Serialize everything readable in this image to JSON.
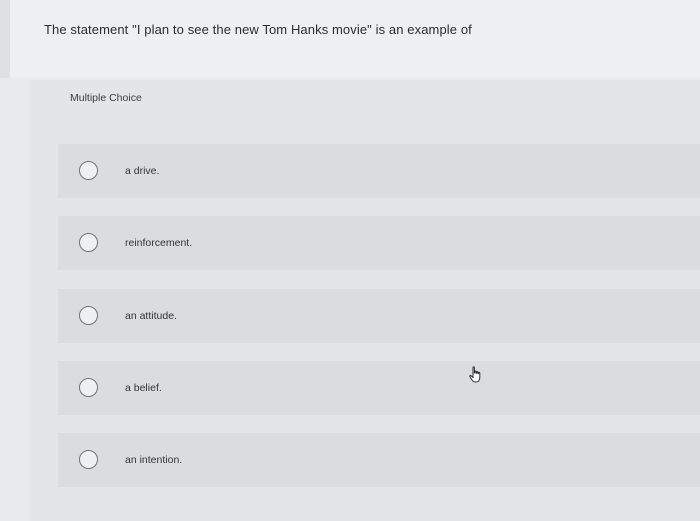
{
  "question": {
    "text": "The statement \"I plan to see the new Tom Hanks movie\" is an example of"
  },
  "answer_panel": {
    "label": "Multiple Choice",
    "options": [
      {
        "label": "a drive.",
        "selected": false
      },
      {
        "label": "reinforcement.",
        "selected": false
      },
      {
        "label": "an attitude.",
        "selected": false
      },
      {
        "label": "a belief.",
        "selected": false
      },
      {
        "label": "an intention.",
        "selected": false
      }
    ]
  },
  "cursor": {
    "icon": "hand-pointer-icon"
  }
}
